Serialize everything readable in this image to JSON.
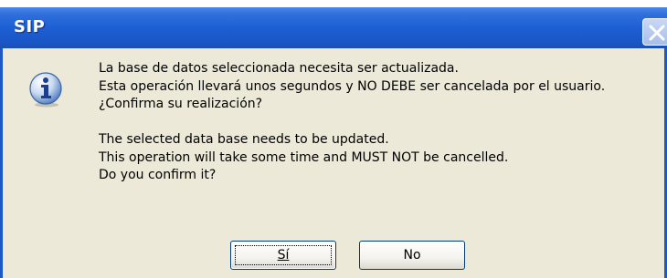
{
  "window": {
    "title": "SIP"
  },
  "message": {
    "es_line1": "La base de datos seleccionada necesita ser actualizada.",
    "es_line2": "Esta operación llevará unos segundos y NO DEBE ser cancelada por el usuario.",
    "es_line3": "¿Confirma su realización?",
    "en_line1": "The selected data base needs to be updated.",
    "en_line2": "This operation will take some time and MUST NOT be cancelled.",
    "en_line3": "Do you confirm it?"
  },
  "buttons": {
    "yes_label": "Sí",
    "no_label": "No"
  },
  "icons": {
    "dialog_icon": "information-icon",
    "close_icon": "close-icon"
  },
  "colors": {
    "titlebar": "#1d5fd4",
    "dialog_bg": "#ece9d8"
  }
}
